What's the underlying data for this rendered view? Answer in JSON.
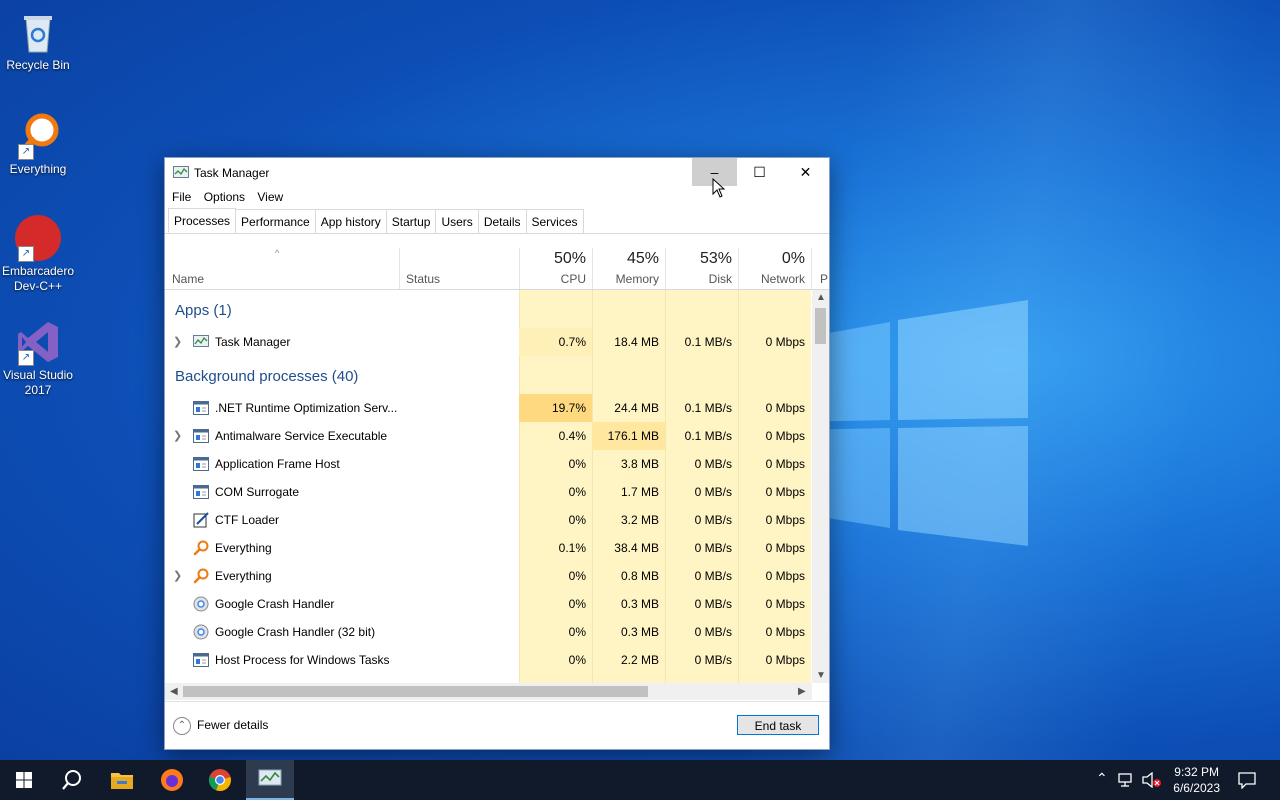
{
  "desktop": {
    "icons": [
      {
        "label": "Recycle Bin"
      },
      {
        "label": "Everything"
      },
      {
        "label": "Embarcadero Dev-C++"
      },
      {
        "label": "Visual Studio 2017"
      }
    ]
  },
  "window": {
    "title": "Task Manager",
    "menu": [
      "File",
      "Options",
      "View"
    ],
    "tabs": [
      "Processes",
      "Performance",
      "App history",
      "Startup",
      "Users",
      "Details",
      "Services"
    ],
    "active_tab": "Processes",
    "columns": {
      "name": "Name",
      "status": "Status",
      "cpu": {
        "pct": "50%",
        "label": "CPU"
      },
      "memory": {
        "pct": "45%",
        "label": "Memory"
      },
      "disk": {
        "pct": "53%",
        "label": "Disk"
      },
      "network": {
        "pct": "0%",
        "label": "Network"
      },
      "power": "P"
    },
    "groups": {
      "apps": "Apps (1)",
      "background": "Background processes (40)"
    },
    "apps": [
      {
        "name": "Task Manager",
        "cpu": "0.7%",
        "memory": "18.4 MB",
        "disk": "0.1 MB/s",
        "network": "0 Mbps",
        "expandable": true,
        "icon": "task-manager-icon"
      }
    ],
    "processes": [
      {
        "name": ".NET Runtime Optimization Serv...",
        "cpu": "19.7%",
        "memory": "24.4 MB",
        "disk": "0.1 MB/s",
        "network": "0 Mbps",
        "expandable": false,
        "icon": "service-icon"
      },
      {
        "name": "Antimalware Service Executable",
        "cpu": "0.4%",
        "memory": "176.1 MB",
        "disk": "0.1 MB/s",
        "network": "0 Mbps",
        "expandable": true,
        "icon": "service-icon"
      },
      {
        "name": "Application Frame Host",
        "cpu": "0%",
        "memory": "3.8 MB",
        "disk": "0 MB/s",
        "network": "0 Mbps",
        "expandable": false,
        "icon": "service-icon"
      },
      {
        "name": "COM Surrogate",
        "cpu": "0%",
        "memory": "1.7 MB",
        "disk": "0 MB/s",
        "network": "0 Mbps",
        "expandable": false,
        "icon": "service-icon"
      },
      {
        "name": "CTF Loader",
        "cpu": "0%",
        "memory": "3.2 MB",
        "disk": "0 MB/s",
        "network": "0 Mbps",
        "expandable": false,
        "icon": "ctf-icon"
      },
      {
        "name": "Everything",
        "cpu": "0.1%",
        "memory": "38.4 MB",
        "disk": "0 MB/s",
        "network": "0 Mbps",
        "expandable": false,
        "icon": "everything-icon"
      },
      {
        "name": "Everything",
        "cpu": "0%",
        "memory": "0.8 MB",
        "disk": "0 MB/s",
        "network": "0 Mbps",
        "expandable": true,
        "icon": "everything-icon"
      },
      {
        "name": "Google Crash Handler",
        "cpu": "0%",
        "memory": "0.3 MB",
        "disk": "0 MB/s",
        "network": "0 Mbps",
        "expandable": false,
        "icon": "google-update-icon"
      },
      {
        "name": "Google Crash Handler (32 bit)",
        "cpu": "0%",
        "memory": "0.3 MB",
        "disk": "0 MB/s",
        "network": "0 Mbps",
        "expandable": false,
        "icon": "google-update-icon"
      },
      {
        "name": "Host Process for Windows Tasks",
        "cpu": "0%",
        "memory": "2.2 MB",
        "disk": "0 MB/s",
        "network": "0 Mbps",
        "expandable": false,
        "icon": "service-icon"
      }
    ],
    "footer": {
      "fewer_details": "Fewer details",
      "end_task": "End task"
    }
  },
  "taskbar": {
    "clock_time": "9:32 PM",
    "clock_date": "6/6/2023"
  }
}
